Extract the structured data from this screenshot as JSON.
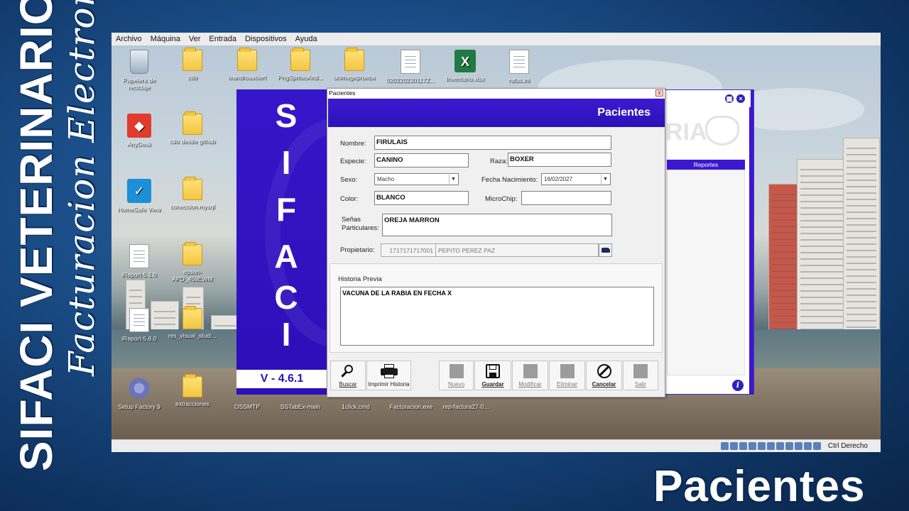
{
  "branding": {
    "title": "SIFACI VETERINARIO",
    "subtitle": "Facturacion Electronica",
    "bottom_title": "Pacientes"
  },
  "vm": {
    "menu": [
      "Archivo",
      "Máquina",
      "Ver",
      "Entrada",
      "Dispositivos",
      "Ayuda"
    ],
    "status_text": "Ctrl Derecho"
  },
  "desktop_icons": [
    {
      "label": "Papelera de reciclaje",
      "icon": "recycle-bin-icon"
    },
    {
      "label": "cdo",
      "icon": "folder-icon"
    },
    {
      "label": "leandroasciert",
      "icon": "folder-icon"
    },
    {
      "label": "PngSpritesAnd...",
      "icon": "folder-icon"
    },
    {
      "label": "ucimageprueba",
      "icon": "folder-icon"
    },
    {
      "label": "020220230117Z...",
      "icon": "web-document-icon"
    },
    {
      "label": "Inventario.xlsx",
      "icon": "excel-icon"
    },
    {
      "label": "rufus.ini",
      "icon": "settings-file-icon"
    },
    {
      "label": "AnyDesk",
      "icon": "anydesk-icon"
    },
    {
      "label": "cdo desde github",
      "icon": "folder-icon"
    },
    {
      "label": "HomeSafe View",
      "icon": "homesafe-icon"
    },
    {
      "label": "coneccion.mysql",
      "icon": "folder-icon"
    },
    {
      "label": "iReport-5.1.0",
      "icon": "document-icon"
    },
    {
      "label": "epson-APD_459EWM",
      "icon": "folder-icon"
    },
    {
      "label": "iReport-5.6.0",
      "icon": "document-icon"
    },
    {
      "label": "res_visual_studi...",
      "icon": "folder-icon"
    },
    {
      "label": "Setup Factory 9",
      "icon": "setup-factory-icon"
    },
    {
      "label": "extracciones",
      "icon": "folder-icon"
    },
    {
      "label": "OSSMTP",
      "icon": "folder-icon"
    },
    {
      "label": "SSTabEx-main",
      "icon": "folder-icon"
    },
    {
      "label": "1click.cmd",
      "icon": "cmd-icon"
    },
    {
      "label": "Facturacion.exe",
      "icon": "app-icon"
    },
    {
      "label": "rep-factura27-0...",
      "icon": "folder-icon"
    }
  ],
  "back_app": {
    "logo_text": "RIA",
    "tab_label": "Reportes",
    "info_glyph": "i"
  },
  "splash": {
    "letters": [
      "S",
      "I",
      "F",
      "A",
      "C",
      "I"
    ],
    "version": "V - 4.6.1"
  },
  "dialog": {
    "window_title": "Pacientes",
    "close_glyph": "x",
    "header_title": "Pacientes",
    "labels": {
      "nombre": "Nombre:",
      "especie": "Especie:",
      "raza": "Raza:",
      "sexo": "Sexo:",
      "fecha_nacimiento": "Fecha Nacimiento:",
      "color": "Color:",
      "microchip": "MicroChip:",
      "senas_line1": "Señas",
      "senas_line2": "Particulares:",
      "propietario": "Propietario:",
      "historia": "Historia Previa"
    },
    "values": {
      "nombre": "FIRULAIS",
      "especie": "CANINO",
      "raza": "BOXER",
      "sexo": "Macho",
      "fecha_nacimiento": "16/02/2027",
      "color": "BLANCO",
      "microchip": "",
      "senas": "OREJA MARRON",
      "propietario_id": "1717171717001",
      "propietario_nombre": "PEPITO PEREZ PAZ",
      "historia": "VACUNA DE LA RABIA EN FECHA X"
    },
    "buttons": [
      {
        "label": "Buscar",
        "icon": "search-icon",
        "enabled": true
      },
      {
        "label": "Imprimir Historia",
        "icon": "printer-icon",
        "enabled": true
      },
      {
        "label": "Nuevo",
        "icon": "new-icon",
        "enabled": false
      },
      {
        "label": "Guardar",
        "icon": "save-icon",
        "enabled": true
      },
      {
        "label": "Modificar",
        "icon": "edit-icon",
        "enabled": false
      },
      {
        "label": "Eliminar",
        "icon": "delete-icon",
        "enabled": false
      },
      {
        "label": "Cancelar",
        "icon": "cancel-icon",
        "enabled": true
      },
      {
        "label": "Salir",
        "icon": "exit-icon",
        "enabled": false
      }
    ]
  },
  "colors": {
    "accent": "#3516c9",
    "header": "#2c11b9"
  }
}
